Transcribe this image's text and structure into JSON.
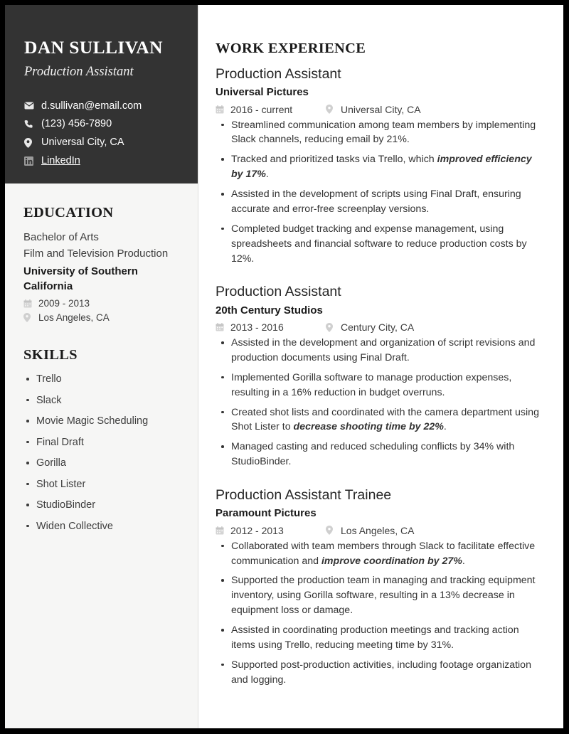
{
  "sidebar": {
    "name": "DAN SULLIVAN",
    "subtitle": "Production Assistant",
    "contacts": [
      {
        "icon": "envelope-icon",
        "text": "d.sullivan@email.com",
        "link": false
      },
      {
        "icon": "phone-icon",
        "text": "(123) 456-7890",
        "link": false
      },
      {
        "icon": "map-pin-icon",
        "text": "Universal City, CA",
        "link": false
      },
      {
        "icon": "linkedin-icon",
        "text": "LinkedIn",
        "link": true
      }
    ],
    "education": {
      "heading": "EDUCATION",
      "degree": "Bachelor of Arts",
      "field": "Film and Television Production",
      "school": "University of Southern California",
      "dates": "2009 - 2013",
      "location": "Los Angeles, CA"
    },
    "skills": {
      "heading": "SKILLS",
      "items": [
        "Trello",
        "Slack",
        "Movie Magic Scheduling",
        "Final Draft",
        "Gorilla",
        "Shot Lister",
        "StudioBinder",
        "Widen Collective"
      ]
    }
  },
  "main": {
    "heading": "WORK EXPERIENCE",
    "jobs": [
      {
        "title": "Production Assistant",
        "company": "Universal Pictures",
        "dates": "2016 - current",
        "location": "Universal City, CA",
        "bullets": [
          {
            "text": "Streamlined communication among team members by implementing Slack channels, reducing email by 21%."
          },
          {
            "pre": "Tracked and prioritized tasks via Trello, which ",
            "strong": "improved efficiency by 17%",
            "post": "."
          },
          {
            "text": "Assisted in the development of scripts using Final Draft, ensuring accurate and error-free screenplay versions."
          },
          {
            "text": "Completed budget tracking and expense management, using spreadsheets and financial software to reduce production costs by 12%."
          }
        ]
      },
      {
        "title": "Production Assistant",
        "company": "20th Century Studios",
        "dates": "2013 - 2016",
        "location": "Century City, CA",
        "bullets": [
          {
            "text": "Assisted in the development and organization of script revisions and production documents using Final Draft."
          },
          {
            "text": "Implemented Gorilla software to manage production expenses, resulting in a 16% reduction in budget overruns."
          },
          {
            "pre": "Created shot lists and coordinated with the camera department using Shot Lister to ",
            "strong": "decrease shooting time by 22%",
            "post": "."
          },
          {
            "text": "Managed casting and reduced scheduling conflicts by 34% with StudioBinder."
          }
        ]
      },
      {
        "title": "Production Assistant Trainee",
        "company": "Paramount Pictures",
        "dates": "2012 - 2013",
        "location": "Los Angeles, CA",
        "bullets": [
          {
            "pre": "Collaborated with team members through Slack to facilitate effective communication and ",
            "strong": "improve coordination by 27%",
            "post": "."
          },
          {
            "text": "Supported the production team in managing and tracking equipment inventory, using Gorilla software, resulting in a 13% decrease in equipment loss or damage."
          },
          {
            "text": "Assisted in coordinating production meetings and tracking action items using Trello, reducing meeting time by 31%."
          },
          {
            "text": "Supported post-production activities, including footage organization and logging."
          }
        ]
      }
    ]
  },
  "colors": {
    "header_background": "#333333",
    "sidebar_background": "#f6f6f5",
    "page_border": "#000000",
    "text_primary": "#1a1a1a",
    "text_body": "#333333",
    "icon_muted": "#cccccc"
  }
}
